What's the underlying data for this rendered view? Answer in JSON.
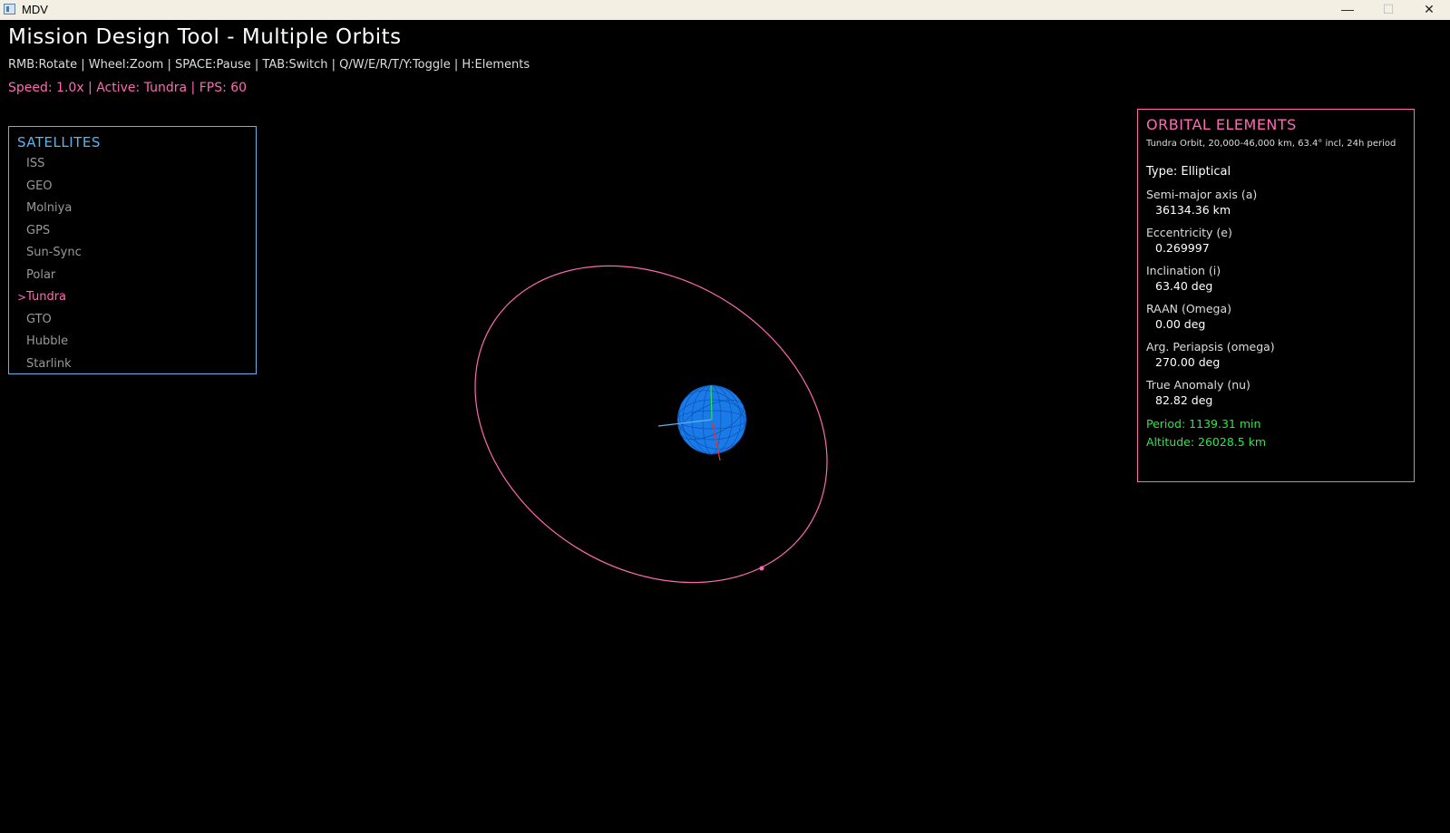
{
  "window": {
    "title": "MDV",
    "minimize": "—",
    "maximize": "☐",
    "close": "✕"
  },
  "header": {
    "title": "Mission Design Tool - Multiple Orbits",
    "help": "RMB:Rotate | Wheel:Zoom | SPACE:Pause | TAB:Switch | Q/W/E/R/T/Y:Toggle | H:Elements",
    "status": "Speed: 1.0x | Active: Tundra | FPS: 60"
  },
  "satellites": {
    "title": "SATELLITES",
    "marker": ">",
    "items": [
      {
        "label": "ISS",
        "active": false
      },
      {
        "label": "GEO",
        "active": false
      },
      {
        "label": "Molniya",
        "active": false
      },
      {
        "label": "GPS",
        "active": false
      },
      {
        "label": "Sun-Sync",
        "active": false
      },
      {
        "label": "Polar",
        "active": false
      },
      {
        "label": "Tundra",
        "active": true
      },
      {
        "label": "GTO",
        "active": false
      },
      {
        "label": "Hubble",
        "active": false
      },
      {
        "label": "Starlink",
        "active": false
      }
    ]
  },
  "elements": {
    "title": "ORBITAL ELEMENTS",
    "description": "Tundra Orbit, 20,000-46,000 km, 63.4° incl, 24h period",
    "type": "Type: Elliptical",
    "items": [
      {
        "label": "Semi-major axis (a)",
        "value": "36134.36 km"
      },
      {
        "label": "Eccentricity (e)",
        "value": "0.269997"
      },
      {
        "label": "Inclination (i)",
        "value": "63.40 deg"
      },
      {
        "label": "RAAN (Omega)",
        "value": "0.00 deg"
      },
      {
        "label": "Arg. Periapsis (omega)",
        "value": "270.00 deg"
      },
      {
        "label": "True Anomaly (nu)",
        "value": "82.82 deg"
      }
    ],
    "period": "Period: 1139.31 min",
    "altitude": "Altitude: 26028.5 km"
  },
  "colors": {
    "accent": "#ff69b4",
    "satellites_border": "#5fb3e8",
    "earth": "#1a7be8",
    "orbit": "#ff69b4",
    "derived": "#2ee64a"
  }
}
